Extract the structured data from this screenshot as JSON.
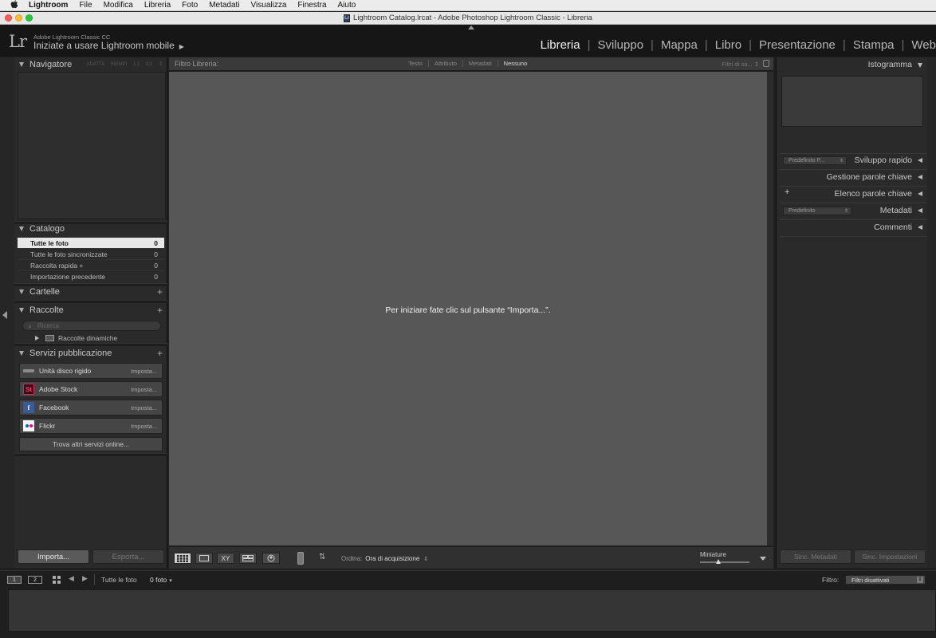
{
  "menubar": {
    "apple": "",
    "items": [
      "Lightroom",
      "File",
      "Modifica",
      "Libreria",
      "Foto",
      "Metadati",
      "Visualizza",
      "Finestra",
      "Aiuto"
    ]
  },
  "window": {
    "title": "Lightroom Catalog.lrcat - Adobe Photoshop Lightroom Classic - Libreria",
    "doc_icon": "Lr"
  },
  "identity": {
    "logo": "Lr",
    "product": "Adobe Lightroom Classic CC",
    "mobile": "Iniziate a usare Lightroom mobile",
    "arrow": "▶"
  },
  "modules": [
    "Libreria",
    "Sviluppo",
    "Mappa",
    "Libro",
    "Presentazione",
    "Stampa",
    "Web"
  ],
  "left": {
    "navigator": {
      "title": "Navigatore",
      "zoom": [
        "ADATTA",
        "RIEMPI",
        "1:1",
        "3:1"
      ],
      "arrow": "⇕"
    },
    "catalog": {
      "title": "Catalogo",
      "rows": [
        {
          "label": "Tutte le foto",
          "count": "0"
        },
        {
          "label": "Tutte le foto sincronizzate",
          "count": "0"
        },
        {
          "label": "Raccolta rapida +",
          "count": "0"
        },
        {
          "label": "Importazione precedente",
          "count": "0"
        }
      ]
    },
    "folders": {
      "title": "Cartelle",
      "plus": "+"
    },
    "collections": {
      "title": "Raccolte",
      "plus": "+",
      "search_placeholder": "Ricerca",
      "smart": "Raccolte dinamiche",
      "mag": "⌕"
    },
    "publish": {
      "title": "Servizi pubblicazione",
      "plus": "+",
      "services": [
        {
          "label": "Unità disco rigido",
          "action": "Imposta...",
          "icon": "disk-icon"
        },
        {
          "label": "Adobe Stock",
          "action": "Imposta...",
          "icon": "adobe-stock-icon",
          "glyph": "St"
        },
        {
          "label": "Facebook",
          "action": "Imposta...",
          "icon": "facebook-icon",
          "glyph": "f"
        },
        {
          "label": "Flickr",
          "action": "Imposta...",
          "icon": "flickr-icon"
        }
      ],
      "find_more": "Trova altri servizi online..."
    },
    "import_button": "Importa...",
    "export_button": "Esporta..."
  },
  "filter": {
    "title": "Filtro Libreria:",
    "tabs": [
      "Testo",
      "Attributo",
      "Metadati",
      "Nessuno"
    ],
    "active_tab": "Nessuno",
    "preset": "Filtri di sa... ⇕"
  },
  "canvas": {
    "prompt": "Per iniziare fate clic sul pulsante “Importa...”."
  },
  "toolbar": {
    "views": [
      "grid-view-icon",
      "loupe-view-icon",
      "compare-view-icon",
      "survey-view-icon",
      "people-view-icon"
    ],
    "compare_glyph": "XY",
    "sort_glyph": "⇅",
    "sort_label": "Ordina:",
    "sort_value": "Ora di acquisizione",
    "sort_arrow": "⇕",
    "thumbs_label": "Miniature"
  },
  "right": {
    "histogram": "Istogramma",
    "quick_develop": "Sviluppo rapido",
    "quick_preset": "Predefinito P...",
    "keywording": "Gestione parole chiave",
    "keyword_list": "Elenco parole chiave",
    "plus": "+",
    "metadata": "Metadati",
    "metadata_preset": "Predefinito",
    "comments": "Commenti",
    "sync_meta": "Sinc. Metadati",
    "sync_settings": "Sinc. Impostazioni",
    "sel_arrow": "⇕"
  },
  "filmbar": {
    "screen1": "1",
    "screen2": "2",
    "back": "◀",
    "forward": "▶",
    "source": "Tutte le foto",
    "count": "0 foto",
    "count_arrow": "▾",
    "filter_label": "Filtro:",
    "filter_value": "Filtri disattivati",
    "filter_arrow": "⇕"
  },
  "colors": {
    "accent_active": "#f0f0f0",
    "canvas": "#575757",
    "panel": "#2a2a2a"
  }
}
